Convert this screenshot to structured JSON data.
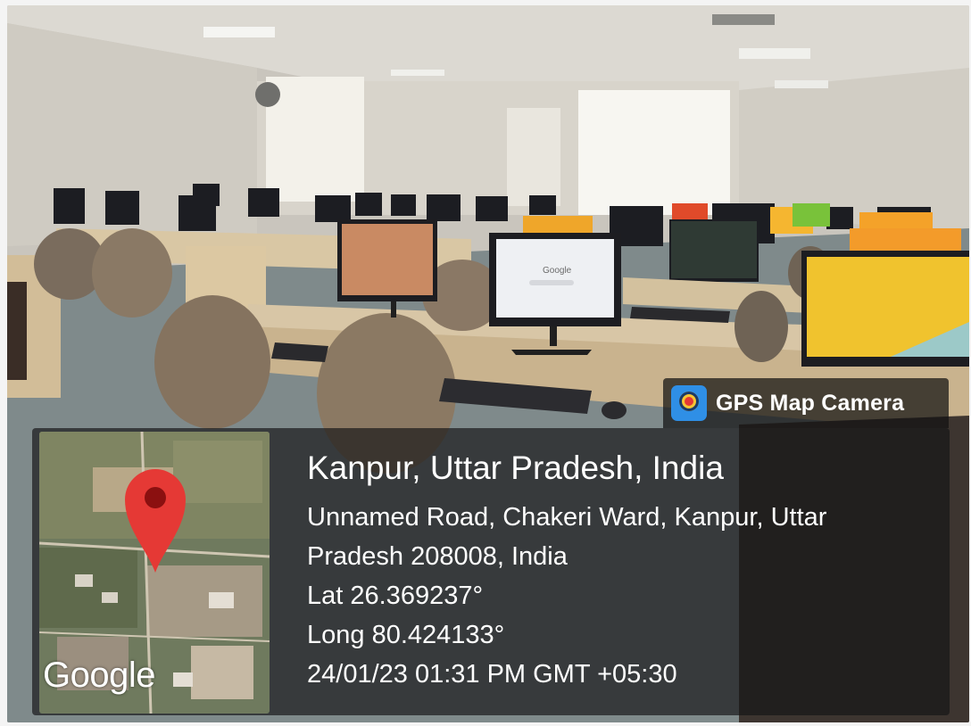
{
  "badge": {
    "label": "GPS Map Camera",
    "icon": "gps-map-camera-icon"
  },
  "location": {
    "city": "Kanpur, Uttar Pradesh, India",
    "address_line1": "Unnamed Road, Chakeri Ward, Kanpur, Uttar",
    "address_line2": "Pradesh 208008, India",
    "latitude": "Lat 26.369237°",
    "longitude": "Long 80.424133°",
    "datetime": "24/01/23 01:31 PM GMT +05:30"
  },
  "map": {
    "provider_logo": "Google",
    "marker_icon": "map-pin-icon",
    "marker_color": "#e53935"
  },
  "monitor_screen": {
    "search_logo": "Google"
  },
  "colors": {
    "panel_bg": "#141416",
    "badge_icon_bg": "#2f8fe6",
    "desktop_yellow": "#f2c22e"
  }
}
